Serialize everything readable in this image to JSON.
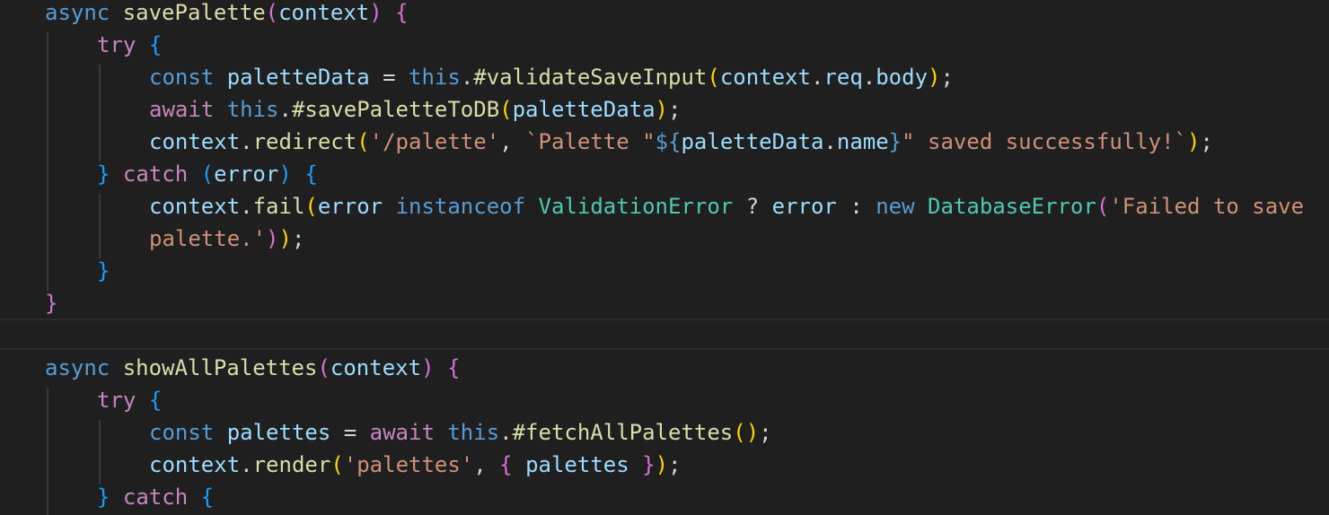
{
  "editor": {
    "lines": [
      [
        {
          "t": "async",
          "c": "kw"
        },
        {
          "t": " ",
          "c": "op"
        },
        {
          "t": "savePalette",
          "c": "fn"
        },
        {
          "t": "(",
          "c": "b2"
        },
        {
          "t": "context",
          "c": "var"
        },
        {
          "t": ")",
          "c": "b2"
        },
        {
          "t": " ",
          "c": "op"
        },
        {
          "t": "{",
          "c": "b2"
        }
      ],
      [
        {
          "t": "try",
          "c": "ctl"
        },
        {
          "t": " ",
          "c": "op"
        },
        {
          "t": "{",
          "c": "b3"
        }
      ],
      [
        {
          "t": "const",
          "c": "kw"
        },
        {
          "t": " ",
          "c": "op"
        },
        {
          "t": "paletteData",
          "c": "var"
        },
        {
          "t": " = ",
          "c": "op"
        },
        {
          "t": "this",
          "c": "kw"
        },
        {
          "t": ".",
          "c": "op"
        },
        {
          "t": "#validateSaveInput",
          "c": "fn"
        },
        {
          "t": "(",
          "c": "b1"
        },
        {
          "t": "context",
          "c": "var"
        },
        {
          "t": ".",
          "c": "op"
        },
        {
          "t": "req",
          "c": "var"
        },
        {
          "t": ".",
          "c": "op"
        },
        {
          "t": "body",
          "c": "var"
        },
        {
          "t": ")",
          "c": "b1"
        },
        {
          "t": ";",
          "c": "op"
        }
      ],
      [
        {
          "t": "await",
          "c": "ctl"
        },
        {
          "t": " ",
          "c": "op"
        },
        {
          "t": "this",
          "c": "kw"
        },
        {
          "t": ".",
          "c": "op"
        },
        {
          "t": "#savePaletteToDB",
          "c": "fn"
        },
        {
          "t": "(",
          "c": "b1"
        },
        {
          "t": "paletteData",
          "c": "var"
        },
        {
          "t": ")",
          "c": "b1"
        },
        {
          "t": ";",
          "c": "op"
        }
      ],
      [
        {
          "t": "context",
          "c": "var"
        },
        {
          "t": ".",
          "c": "op"
        },
        {
          "t": "redirect",
          "c": "fn"
        },
        {
          "t": "(",
          "c": "b1"
        },
        {
          "t": "'/palette'",
          "c": "str"
        },
        {
          "t": ", ",
          "c": "op"
        },
        {
          "t": "`Palette \"",
          "c": "str"
        },
        {
          "t": "${",
          "c": "kw"
        },
        {
          "t": "paletteData",
          "c": "var"
        },
        {
          "t": ".",
          "c": "op"
        },
        {
          "t": "name",
          "c": "var"
        },
        {
          "t": "}",
          "c": "kw"
        },
        {
          "t": "\" saved successfully!`",
          "c": "str"
        },
        {
          "t": ")",
          "c": "b1"
        },
        {
          "t": ";",
          "c": "op"
        }
      ],
      [
        {
          "t": "}",
          "c": "b3"
        },
        {
          "t": " ",
          "c": "op"
        },
        {
          "t": "catch",
          "c": "ctl"
        },
        {
          "t": " ",
          "c": "op"
        },
        {
          "t": "(",
          "c": "b3"
        },
        {
          "t": "error",
          "c": "var"
        },
        {
          "t": ")",
          "c": "b3"
        },
        {
          "t": " ",
          "c": "op"
        },
        {
          "t": "{",
          "c": "b3"
        }
      ],
      [
        {
          "t": "context",
          "c": "var"
        },
        {
          "t": ".",
          "c": "op"
        },
        {
          "t": "fail",
          "c": "fn"
        },
        {
          "t": "(",
          "c": "b1"
        },
        {
          "t": "error",
          "c": "var"
        },
        {
          "t": " ",
          "c": "op"
        },
        {
          "t": "instanceof",
          "c": "kw"
        },
        {
          "t": " ",
          "c": "op"
        },
        {
          "t": "ValidationError",
          "c": "typ"
        },
        {
          "t": " ? ",
          "c": "op"
        },
        {
          "t": "error",
          "c": "var"
        },
        {
          "t": " : ",
          "c": "op"
        },
        {
          "t": "new",
          "c": "kw"
        },
        {
          "t": " ",
          "c": "op"
        },
        {
          "t": "DatabaseError",
          "c": "typ"
        },
        {
          "t": "(",
          "c": "b2"
        },
        {
          "t": "'Failed to save",
          "c": "str"
        }
      ],
      [
        {
          "t": "palette.'",
          "c": "str"
        },
        {
          "t": ")",
          "c": "b2"
        },
        {
          "t": ")",
          "c": "b1"
        },
        {
          "t": ";",
          "c": "op"
        }
      ],
      [
        {
          "t": "}",
          "c": "b3"
        }
      ],
      [
        {
          "t": "}",
          "c": "b2"
        }
      ],
      [],
      [
        {
          "t": "async",
          "c": "kw"
        },
        {
          "t": " ",
          "c": "op"
        },
        {
          "t": "showAllPalettes",
          "c": "fn"
        },
        {
          "t": "(",
          "c": "b2"
        },
        {
          "t": "context",
          "c": "var"
        },
        {
          "t": ")",
          "c": "b2"
        },
        {
          "t": " ",
          "c": "op"
        },
        {
          "t": "{",
          "c": "b2"
        }
      ],
      [
        {
          "t": "try",
          "c": "ctl"
        },
        {
          "t": " ",
          "c": "op"
        },
        {
          "t": "{",
          "c": "b3"
        }
      ],
      [
        {
          "t": "const",
          "c": "kw"
        },
        {
          "t": " ",
          "c": "op"
        },
        {
          "t": "palettes",
          "c": "var"
        },
        {
          "t": " = ",
          "c": "op"
        },
        {
          "t": "await",
          "c": "ctl"
        },
        {
          "t": " ",
          "c": "op"
        },
        {
          "t": "this",
          "c": "kw"
        },
        {
          "t": ".",
          "c": "op"
        },
        {
          "t": "#fetchAllPalettes",
          "c": "fn"
        },
        {
          "t": "(",
          "c": "b1"
        },
        {
          "t": ")",
          "c": "b1"
        },
        {
          "t": ";",
          "c": "op"
        }
      ],
      [
        {
          "t": "context",
          "c": "var"
        },
        {
          "t": ".",
          "c": "op"
        },
        {
          "t": "render",
          "c": "fn"
        },
        {
          "t": "(",
          "c": "b1"
        },
        {
          "t": "'palettes'",
          "c": "str"
        },
        {
          "t": ", ",
          "c": "op"
        },
        {
          "t": "{",
          "c": "b2"
        },
        {
          "t": " palettes ",
          "c": "var"
        },
        {
          "t": "}",
          "c": "b2"
        },
        {
          "t": ")",
          "c": "b1"
        },
        {
          "t": ";",
          "c": "op"
        }
      ],
      [
        {
          "t": "}",
          "c": "b3"
        },
        {
          "t": " ",
          "c": "op"
        },
        {
          "t": "catch",
          "c": "ctl"
        },
        {
          "t": " ",
          "c": "op"
        },
        {
          "t": "{",
          "c": "b3"
        }
      ]
    ]
  }
}
